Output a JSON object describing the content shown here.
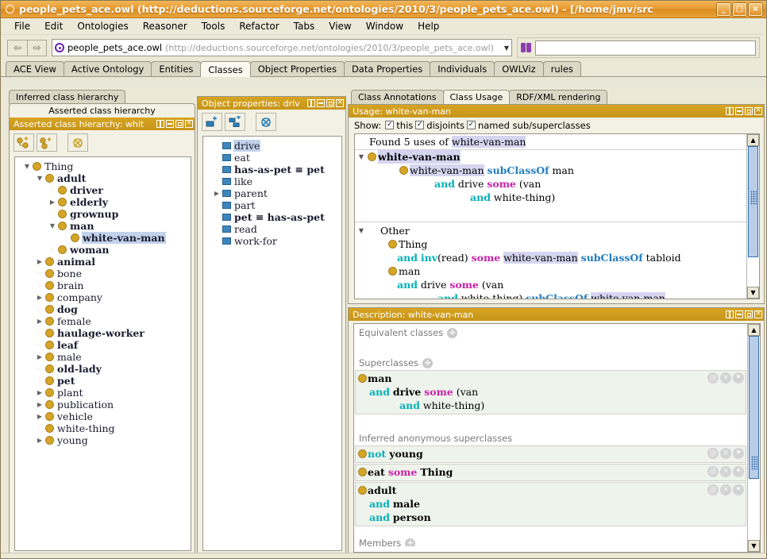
{
  "window": {
    "title": "people_pets_ace.owl (http://deductions.sourceforge.net/ontologies/2010/3/people_pets_ace.owl) - [/home/jmv/src",
    "minimize": "_",
    "maximize": "□",
    "close": "×"
  },
  "menu": {
    "items": [
      "File",
      "Edit",
      "Ontologies",
      "Reasoner",
      "Tools",
      "Refactor",
      "Tabs",
      "View",
      "Window",
      "Help"
    ]
  },
  "toolbar": {
    "back": "⇦",
    "forward": "⇨",
    "ontology_name": "people_pets_ace.owl",
    "ontology_uri": "(http://deductions.sourceforge.net/ontologies/2010/3/people_pets_ace.owl)",
    "dropdown_arrow": "▼",
    "search_value": "",
    "search_placeholder": ""
  },
  "main_tabs": [
    {
      "label": "ACE View",
      "active": false
    },
    {
      "label": "Active Ontology",
      "active": false
    },
    {
      "label": "Entities",
      "active": false
    },
    {
      "label": "Classes",
      "active": true
    },
    {
      "label": "Object Properties",
      "active": false
    },
    {
      "label": "Data Properties",
      "active": false
    },
    {
      "label": "Individuals",
      "active": false
    },
    {
      "label": "OWLViz",
      "active": false
    },
    {
      "label": "rules",
      "active": false
    }
  ],
  "class_hierarchy": {
    "tab_inferred": "Inferred class hierarchy",
    "tab_asserted": "Asserted class hierarchy",
    "panel_title": "Asserted class hierarchy: whit",
    "toolbar_icons": [
      "add-subclass-icon",
      "add-sibling-class-icon",
      "delete-class-icon"
    ],
    "tree": [
      {
        "label": "Thing",
        "depth": 0,
        "twist": "▼",
        "bold": false,
        "selected": false
      },
      {
        "label": "adult",
        "depth": 1,
        "twist": "▼",
        "bold": true,
        "selected": false
      },
      {
        "label": "driver",
        "depth": 2,
        "twist": "",
        "bold": true,
        "selected": false
      },
      {
        "label": "elderly",
        "depth": 2,
        "twist": "▶",
        "bold": true,
        "selected": false
      },
      {
        "label": "grownup",
        "depth": 2,
        "twist": "",
        "bold": true,
        "selected": false
      },
      {
        "label": "man",
        "depth": 2,
        "twist": "▼",
        "bold": true,
        "selected": false
      },
      {
        "label": "white-van-man",
        "depth": 3,
        "twist": "",
        "bold": true,
        "selected": true
      },
      {
        "label": "woman",
        "depth": 2,
        "twist": "",
        "bold": true,
        "selected": false
      },
      {
        "label": "animal",
        "depth": 1,
        "twist": "▶",
        "bold": true,
        "selected": false
      },
      {
        "label": "bone",
        "depth": 1,
        "twist": "",
        "bold": false,
        "selected": false
      },
      {
        "label": "brain",
        "depth": 1,
        "twist": "",
        "bold": false,
        "selected": false
      },
      {
        "label": "company",
        "depth": 1,
        "twist": "▶",
        "bold": false,
        "selected": false
      },
      {
        "label": "dog",
        "depth": 1,
        "twist": "",
        "bold": true,
        "selected": false
      },
      {
        "label": "female",
        "depth": 1,
        "twist": "▶",
        "bold": false,
        "selected": false
      },
      {
        "label": "haulage-worker",
        "depth": 1,
        "twist": "",
        "bold": true,
        "selected": false
      },
      {
        "label": "leaf",
        "depth": 1,
        "twist": "",
        "bold": true,
        "selected": false
      },
      {
        "label": "male",
        "depth": 1,
        "twist": "▶",
        "bold": false,
        "selected": false
      },
      {
        "label": "old-lady",
        "depth": 1,
        "twist": "",
        "bold": true,
        "selected": false
      },
      {
        "label": "pet",
        "depth": 1,
        "twist": "",
        "bold": true,
        "selected": false
      },
      {
        "label": "plant",
        "depth": 1,
        "twist": "▶",
        "bold": false,
        "selected": false
      },
      {
        "label": "publication",
        "depth": 1,
        "twist": "▶",
        "bold": false,
        "selected": false
      },
      {
        "label": "vehicle",
        "depth": 1,
        "twist": "▶",
        "bold": false,
        "selected": false
      },
      {
        "label": "white-thing",
        "depth": 1,
        "twist": "",
        "bold": false,
        "selected": false
      },
      {
        "label": "young",
        "depth": 1,
        "twist": "▶",
        "bold": false,
        "selected": false
      }
    ]
  },
  "object_properties": {
    "panel_title": "Object properties: driv",
    "toolbar_icons": [
      "add-property-icon",
      "add-subproperty-icon",
      "delete-property-icon"
    ],
    "tree": [
      {
        "label": "drive",
        "twist": "",
        "bold": false,
        "selected": true
      },
      {
        "label": "eat",
        "twist": "",
        "bold": false,
        "selected": false
      },
      {
        "label": "has-as-pet ≡ pet",
        "twist": "",
        "bold": true,
        "selected": false
      },
      {
        "label": "like",
        "twist": "",
        "bold": false,
        "selected": false
      },
      {
        "label": "parent",
        "twist": "▶",
        "bold": false,
        "selected": false
      },
      {
        "label": "part",
        "twist": "",
        "bold": false,
        "selected": false
      },
      {
        "label": "pet ≡ has-as-pet",
        "twist": "",
        "bold": true,
        "selected": false
      },
      {
        "label": "read",
        "twist": "",
        "bold": false,
        "selected": false
      },
      {
        "label": "work-for",
        "twist": "",
        "bold": false,
        "selected": false
      }
    ]
  },
  "usage": {
    "tabs": [
      {
        "label": "Class Annotations",
        "active": false
      },
      {
        "label": "Class Usage",
        "active": true
      },
      {
        "label": "RDF/XML rendering",
        "active": false
      }
    ],
    "panel_title": "Usage: white-van-man",
    "show_label": "Show:",
    "checkboxes": [
      {
        "label": "this",
        "checked": true
      },
      {
        "label": "disjoints",
        "checked": true
      },
      {
        "label": "named sub/superclasses",
        "checked": true
      }
    ],
    "found_prefix": "Found 5 uses of ",
    "found_term": "white-van-man",
    "root_label": "white-van-man",
    "other_label": "Other",
    "entries": [
      [
        "white-van-man",
        "subClassOf",
        "man"
      ],
      [
        "and",
        "drive",
        "some",
        "(van"
      ],
      [
        "and",
        "white-thing)"
      ]
    ]
  },
  "description": {
    "panel_title": "Description: white-van-man",
    "equivalent_classes_label": "Equivalent classes",
    "superclasses_label": "Superclasses",
    "inferred_label": "Inferred anonymous superclasses",
    "members_label": "Members",
    "superclass_items": [
      {
        "lines": [
          "man",
          "and drive some (van",
          "and white-thing)"
        ]
      }
    ],
    "inferred_items": [
      {
        "lines": [
          "not young"
        ]
      },
      {
        "lines": [
          "eat some Thing"
        ]
      },
      {
        "lines": [
          "adult",
          "and male",
          "and person"
        ]
      }
    ],
    "row_buttons": [
      "annotate-icon",
      "delete-icon",
      "edit-icon"
    ]
  },
  "colors": {
    "title_bar": "#e89c33",
    "panel_header": "#d7a521",
    "accent_blue": "#1f7bbf",
    "accent_cyan": "#00b0b8",
    "accent_magenta": "#c81fa8",
    "class_dot": "#d5a528",
    "property_square": "#3d86bd",
    "selection": "#c2d2ea",
    "highlight": "#d5d5f0"
  }
}
